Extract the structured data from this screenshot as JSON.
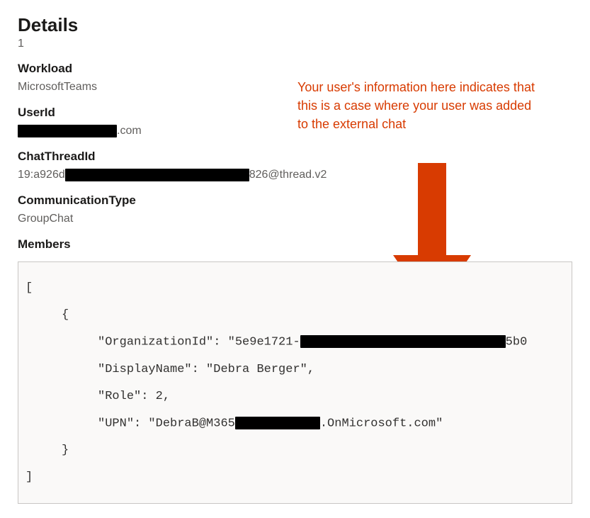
{
  "title": "Details",
  "count": "1",
  "fields": {
    "workload": {
      "label": "Workload",
      "value": "MicrosoftTeams"
    },
    "userid": {
      "label": "UserId",
      "prefix": "",
      "suffix": ".com"
    },
    "chatthreadid": {
      "label": "ChatThreadId",
      "prefix": "19:a926d",
      "suffix": "826@thread.v2"
    },
    "commtype": {
      "label": "CommunicationType",
      "value": "GroupChat"
    },
    "members": {
      "label": "Members"
    }
  },
  "annotation": "Your user's information here indicates that this is a case where your user was added to the external chat",
  "code": {
    "l1": "[",
    "l2": "     {",
    "l3a": "          \"OrganizationId\": \"5e9e1721-",
    "l3b": "5b0",
    "l4": "          \"DisplayName\": \"Debra Berger\",",
    "l5": "          \"Role\": 2,",
    "l6a": "          \"UPN\": \"DebraB@M365",
    "l6b": ".OnMicrosoft.com\"",
    "l7": "     }",
    "l8": "]"
  },
  "colors": {
    "accent_red": "#d83b01"
  }
}
